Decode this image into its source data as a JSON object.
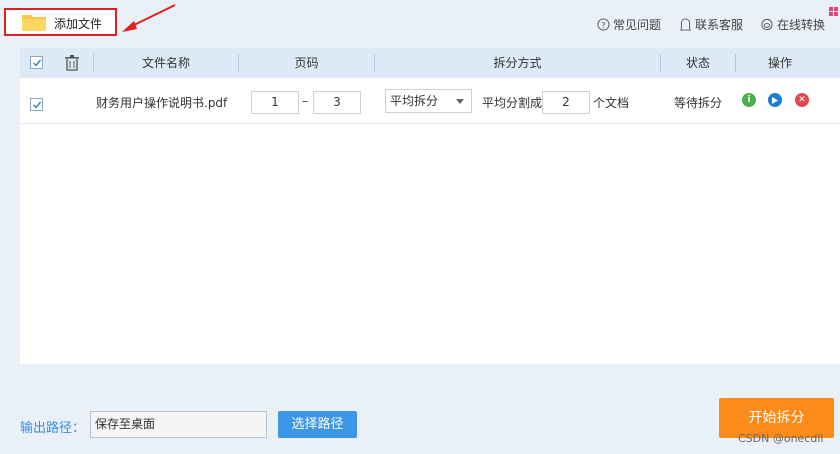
{
  "toolbar": {
    "add_file_label": "添加文件",
    "faq_label": "常见问题",
    "contact_label": "联系客服",
    "online_label": "在线转换"
  },
  "table": {
    "headers": {
      "filename": "文件名称",
      "pages": "页码",
      "split_mode": "拆分方式",
      "status": "状态",
      "actions": "操作"
    },
    "rows": [
      {
        "checked": true,
        "filename": "财务用户操作说明书.pdf",
        "page_from": "1",
        "page_dash": "–",
        "page_to": "3",
        "split_mode": "平均拆分",
        "split_prefix": "平均分割成",
        "split_count": "2",
        "split_suffix": "个文档",
        "status": "等待拆分"
      }
    ]
  },
  "footer": {
    "output_label": "输出路径：",
    "output_value": "保存至桌面",
    "choose_path_label": "选择路径",
    "start_label": "开始拆分",
    "watermark": "CSDN @onecdll"
  },
  "colors": {
    "accent_blue": "#3c97e6",
    "start_orange": "#fb8c1a",
    "highlight_red": "#e02020",
    "info_green": "#4cae4c",
    "play_blue": "#1a7fd4",
    "delete_red": "#e5484d"
  },
  "icons": [
    "folder-icon",
    "arrow-annotation",
    "question-icon",
    "support-icon",
    "online-icon",
    "grid-icon",
    "trash-icon",
    "checkbox-icon",
    "info-icon",
    "play-icon",
    "delete-icon"
  ]
}
